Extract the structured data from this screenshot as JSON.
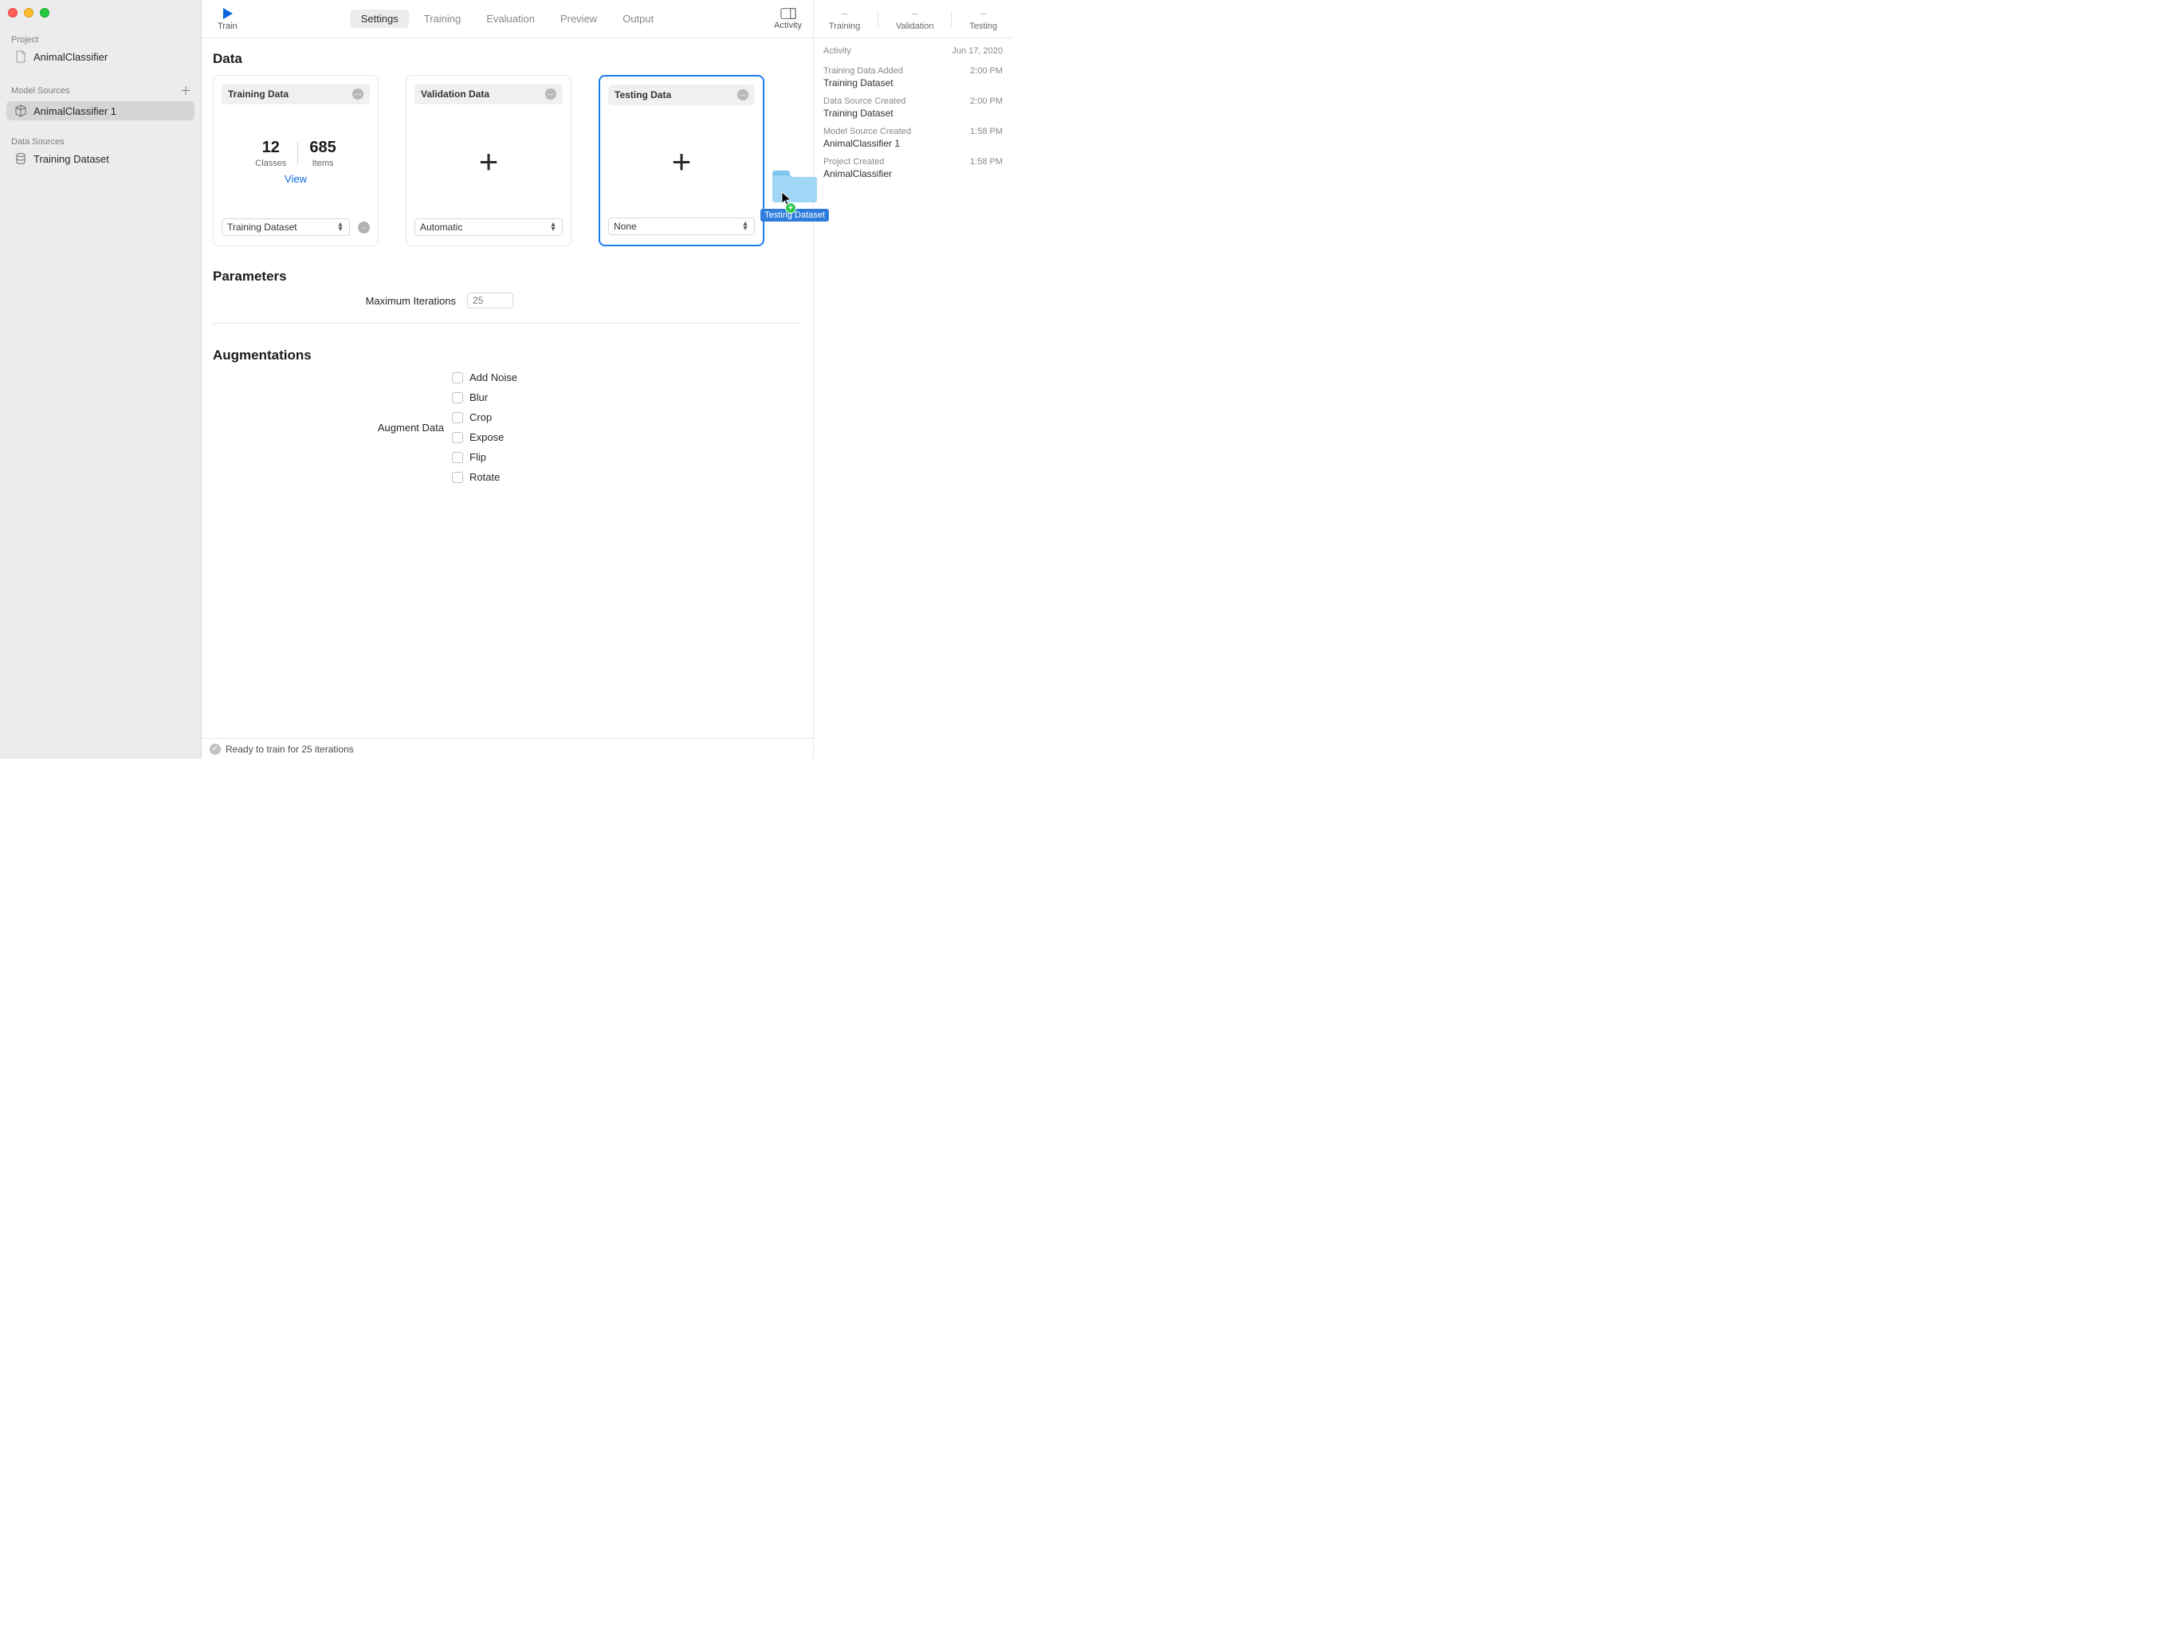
{
  "sidebar": {
    "project_header": "Project",
    "project_name": "AnimalClassifier",
    "model_sources_header": "Model Sources",
    "model_sources": [
      {
        "label": "AnimalClassifier 1"
      }
    ],
    "data_sources_header": "Data Sources",
    "data_sources": [
      {
        "label": "Training Dataset"
      }
    ]
  },
  "toolbar": {
    "train_label": "Train",
    "tabs": [
      "Settings",
      "Training",
      "Evaluation",
      "Preview",
      "Output"
    ],
    "activity_label": "Activity"
  },
  "data_section": {
    "title": "Data",
    "training": {
      "title": "Training Data",
      "classes_value": "12",
      "classes_label": "Classes",
      "items_value": "685",
      "items_label": "Items",
      "view_label": "View",
      "dropdown": "Training Dataset"
    },
    "validation": {
      "title": "Validation Data",
      "dropdown": "Automatic"
    },
    "testing": {
      "title": "Testing Data",
      "dropdown": "None"
    }
  },
  "parameters": {
    "title": "Parameters",
    "max_iter_label": "Maximum Iterations",
    "max_iter_placeholder": "25"
  },
  "augmentations": {
    "title": "Augmentations",
    "label": "Augment Data",
    "options": [
      "Add Noise",
      "Blur",
      "Crop",
      "Expose",
      "Flip",
      "Rotate"
    ]
  },
  "status": {
    "text": "Ready to train for 25 iterations"
  },
  "activity_top": {
    "training_label": "Training",
    "validation_label": "Validation",
    "testing_label": "Testing",
    "dash": "–"
  },
  "activity": {
    "header": "Activity",
    "date": "Jun 17, 2020",
    "items": [
      {
        "title": "Training Data Added",
        "detail": "Training Dataset",
        "time": "2:00 PM"
      },
      {
        "title": "Data Source Created",
        "detail": "Training Dataset",
        "time": "2:00 PM"
      },
      {
        "title": "Model Source Created",
        "detail": "AnimalClassifier 1",
        "time": "1:58 PM"
      },
      {
        "title": "Project Created",
        "detail": "AnimalClassifier",
        "time": "1:58 PM"
      }
    ]
  },
  "drag_item": {
    "label": "Testing Dataset"
  }
}
